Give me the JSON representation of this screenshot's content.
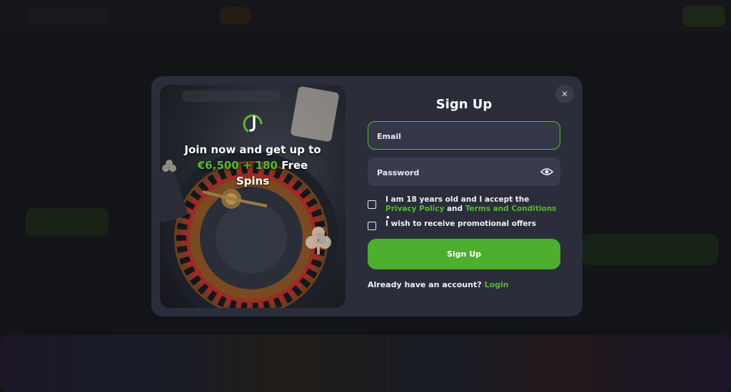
{
  "promo": {
    "line1": "Join now and get up to",
    "highlight": "€6,500 + 180",
    "line2_rest": "Free",
    "line3": "Spins"
  },
  "modal": {
    "title": "Sign Up",
    "close_glyph": "✕",
    "email_placeholder": "Email",
    "password_placeholder": "Password",
    "terms_prefix": "I am 18 years old and I accept the",
    "privacy_link": "Privacy Policy",
    "terms_and": "and",
    "terms_link": "Terms and Conditions",
    "required_mark": "•",
    "promo_offers": "I wish to receive promotional offers",
    "submit_label": "Sign Up",
    "already_text": "Already have an account?",
    "login_link": "Login"
  },
  "colors": {
    "accent": "#56b832",
    "modal_bg": "#2b2d3b",
    "field_bg": "#3a3c4e"
  },
  "icons": {
    "close": "close-icon",
    "eye": "eye-icon",
    "logo": "brand-logo-icon"
  }
}
